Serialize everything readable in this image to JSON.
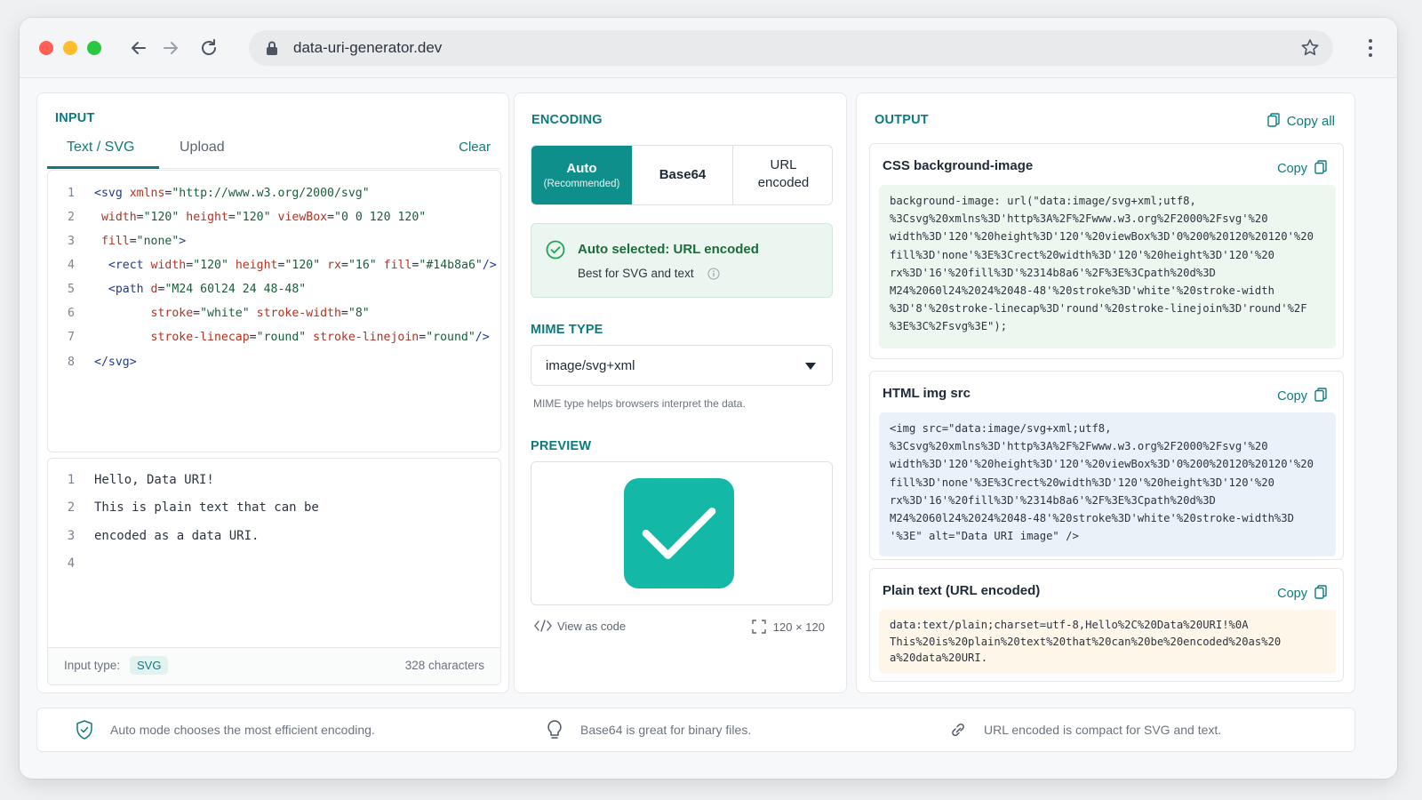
{
  "browser": {
    "url": "data-uri-generator.dev"
  },
  "input": {
    "title": "INPUT",
    "tabs": [
      "Text / SVG",
      "Upload"
    ],
    "clear_label": "Clear",
    "svg_lines": [
      {
        "n": "1",
        "code": "<svg xmlns=\"http://www.w3.org/2000/svg\""
      },
      {
        "n": "2",
        "code": " width=\"120\" height=\"120\" viewBox=\"0 0 120 120\""
      },
      {
        "n": "3",
        "code": " fill=\"none\">"
      },
      {
        "n": "4",
        "code": "  <rect width=\"120\" height=\"120\" rx=\"16\" fill=\"#14b8a6\"/>"
      },
      {
        "n": "5",
        "code": "  <path d=\"M24 60l24 24 48-48\""
      },
      {
        "n": "6",
        "code": "        stroke=\"white\" stroke-width=\"8\""
      },
      {
        "n": "7",
        "code": "        stroke-linecap=\"round\" stroke-linejoin=\"round\"/>"
      },
      {
        "n": "8",
        "code": "</svg>"
      }
    ],
    "text_lines": [
      {
        "n": "1",
        "text": "Hello, Data URI!"
      },
      {
        "n": "2",
        "text": "This is plain text that can be"
      },
      {
        "n": "3",
        "text": "encoded as a data URI."
      },
      {
        "n": "4",
        "text": ""
      }
    ],
    "footer": {
      "type_label": "Input type:",
      "type_value": "SVG",
      "count": "328 characters"
    }
  },
  "encoding": {
    "title": "ENCODING",
    "options": {
      "auto": "Auto",
      "auto_sub": "(Recommended)",
      "base64": "Base64",
      "url_line1": "URL",
      "url_line2": "encoded"
    },
    "selected": "Auto",
    "alert_title": "Auto selected: URL encoded",
    "alert_sub": "Best for SVG and text",
    "mime_title": "MIME TYPE",
    "mime_value": "image/svg+xml",
    "mime_help": "MIME type helps browsers interpret the data.",
    "preview_title": "PREVIEW",
    "view_code": "View as code",
    "dimensions": "120 × 120"
  },
  "output": {
    "title": "OUTPUT",
    "copy_all": "Copy all",
    "copy_label": "Copy",
    "cards": {
      "css_title": "CSS background-image",
      "css_code": "background-image: url(\"data:image/svg+xml;utf8,\n%3Csvg%20xmlns%3D'http%3A%2F%2Fwww.w3.org%2F2000%2Fsvg'%20\nwidth%3D'120'%20height%3D'120'%20viewBox%3D'0%200%20120%20120'%20\nfill%3D'none'%3E%3Crect%20width%3D'120'%20height%3D'120'%20\nrx%3D'16'%20fill%3D'%2314b8a6'%2F%3E%3Cpath%20d%3D\nM24%2060l24%2024%2048-48'%20stroke%3D'white'%20stroke-width\n%3D'8'%20stroke-linecap%3D'round'%20stroke-linejoin%3D'round'%2F\n%3E%3C%2Fsvg%3E\");",
      "html_title": "HTML img src",
      "html_code": "<img src=\"data:image/svg+xml;utf8,\n%3Csvg%20xmlns%3D'http%3A%2F%2Fwww.w3.org%2F2000%2Fsvg'%20\nwidth%3D'120'%20height%3D'120'%20viewBox%3D'0%200%20120%20120'%20\nfill%3D'none'%3E%3Crect%20width%3D'120'%20height%3D'120'%20\nrx%3D'16'%20fill%3D'%2314b8a6'%2F%3E%3Cpath%20d%3D\nM24%2060l24%2024%2048-48'%20stroke%3D'white'%20stroke-width%3D\n'%3E\" alt=\"Data URI image\" />",
      "plain_title": "Plain text (URL encoded)",
      "plain_code": "data:text/plain;charset=utf-8,Hello%2C%20Data%20URI!%0A\nThis%20is%20plain%20text%20that%20can%20be%20encoded%20as%20\na%20data%20URI."
    }
  },
  "tips": [
    "Auto mode chooses the most efficient encoding.",
    "Base64 is great for binary files.",
    "URL encoded is compact for SVG and text."
  ],
  "colors": {
    "accent": "#0e7a7e",
    "auto_button": "#0f8f8c",
    "preview_fill": "#14b8a6",
    "success_bg": "#eaf6ef"
  }
}
